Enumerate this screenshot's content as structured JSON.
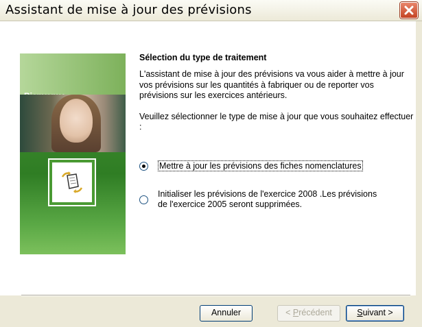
{
  "window": {
    "title": "Assistant de mise à jour des prévisions"
  },
  "sidebar": {
    "label": "Bienvenue"
  },
  "main": {
    "heading": "Sélection du type de traitement",
    "intro": "L'assistant de mise à jour des prévisions va vous aider à mettre à jour vos prévisions sur les quantités à fabriquer ou de reporter vos prévisions sur les exercices antérieurs.",
    "prompt": "Veuillez sélectionner le type de mise à jour que vous souhaitez effectuer :",
    "options": [
      {
        "label": "Mettre à jour les prévisions des fiches nomenclatures",
        "selected": true
      },
      {
        "label_line1": "Initialiser les prévisions de l'exercice 2008 .Les prévisions",
        "label_line2": "de l'exercice 2005 seront supprimées.",
        "selected": false
      }
    ]
  },
  "buttons": {
    "cancel": "Annuler",
    "previous_prefix": "< ",
    "previous_accel": "P",
    "previous_rest": "récédent",
    "next_accel": "S",
    "next_rest": "uivant >"
  },
  "colors": {
    "accent_green": "#4a9a33",
    "close_red": "#c44223",
    "dialog_bg": "#ece9d8"
  },
  "icons": [
    "close-icon",
    "document-arrows-icon"
  ]
}
